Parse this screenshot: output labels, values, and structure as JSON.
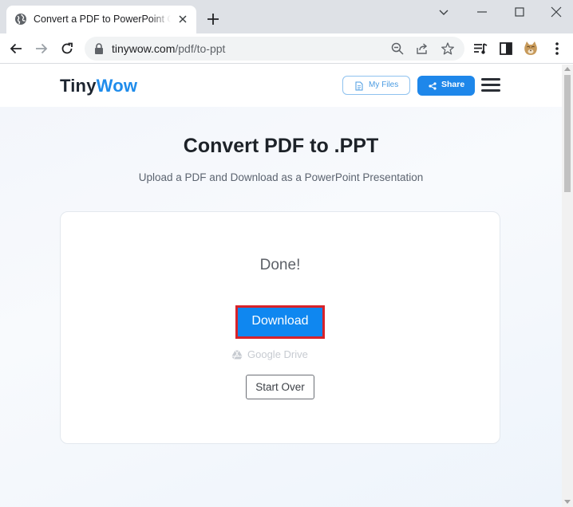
{
  "browser": {
    "tab": {
      "title": "Convert a PDF to PowerPoint Online",
      "favicon": "globe-icon"
    },
    "address_bar": {
      "domain": "tinywow.com",
      "path": "/pdf/to-ppt"
    },
    "icons": {
      "back": "arrow-left-icon",
      "forward": "arrow-right-icon",
      "reload": "reload-icon",
      "zoom": "zoom-icon",
      "share": "share-icon",
      "bookmark": "star-icon",
      "reading_list": "reading-list-icon",
      "side_panel": "side-panel-icon",
      "profile": "avatar",
      "menu": "kebab-menu-icon"
    }
  },
  "site": {
    "logo_tiny": "Tiny",
    "logo_wow": "Wow",
    "my_files_label": "My Files",
    "share_label": "Share",
    "brand_color": "#1f8ceb"
  },
  "main": {
    "title": "Convert PDF to .PPT",
    "subtitle": "Upload a PDF and Download as a PowerPoint Presentation"
  },
  "result_card": {
    "status": "Done!",
    "download_label": "Download",
    "google_drive_label": "Google Drive",
    "start_over_label": "Start Over",
    "download_color": "#0f87f0",
    "highlight_color": "#d8232a"
  }
}
